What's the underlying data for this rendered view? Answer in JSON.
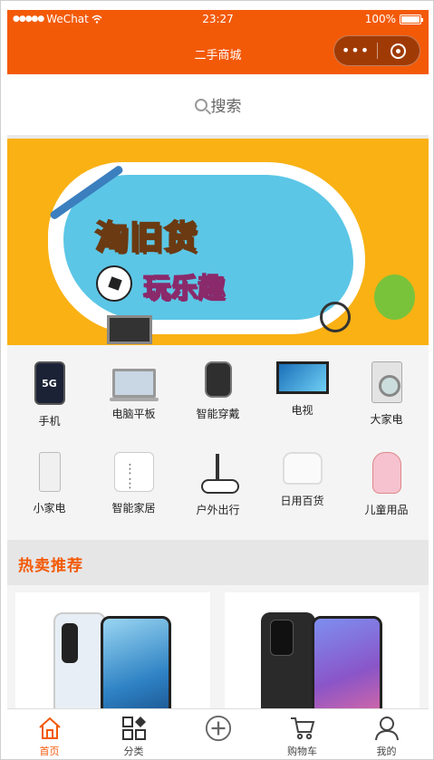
{
  "status_bar": {
    "carrier": "WeChat",
    "signal": "●●●●●",
    "time": "23:27",
    "battery": "100%",
    "battery_level": 1.0
  },
  "nav": {
    "title": "二手商城",
    "more_glyph": "•••"
  },
  "search": {
    "placeholder": "搜索"
  },
  "banner": {
    "headline": "淘旧货",
    "subline": "玩乐趣",
    "slides": 3,
    "active_slide": 0
  },
  "categories": [
    {
      "label": "手机",
      "icon": "phone-icon",
      "badge": "5G"
    },
    {
      "label": "电脑平板",
      "icon": "laptop-icon"
    },
    {
      "label": "智能穿戴",
      "icon": "smartwatch-icon"
    },
    {
      "label": "电视",
      "icon": "tv-icon"
    },
    {
      "label": "大家电",
      "icon": "washing-machine-icon"
    },
    {
      "label": "小家电",
      "icon": "air-purifier-icon"
    },
    {
      "label": "智能家居",
      "icon": "smart-socket-icon"
    },
    {
      "label": "户外出行",
      "icon": "scooter-icon"
    },
    {
      "label": "日用百货",
      "icon": "rice-cooker-icon"
    },
    {
      "label": "儿童用品",
      "icon": "toy-icon"
    }
  ],
  "section": {
    "title": "热卖推荐"
  },
  "products": [
    {
      "image": "white-smartphone-photo"
    },
    {
      "image": "black-smartphone-photo"
    }
  ],
  "tabbar": [
    {
      "label": "首页",
      "icon": "home-icon",
      "active": true
    },
    {
      "label": "分类",
      "icon": "category-grid-icon",
      "active": false
    },
    {
      "label": "",
      "icon": "plus-circle-icon",
      "active": false
    },
    {
      "label": "购物车",
      "icon": "cart-icon",
      "active": false
    },
    {
      "label": "我的",
      "icon": "user-icon",
      "active": false
    }
  ],
  "colors": {
    "accent": "#f35a08",
    "banner_bg": "#f9b114",
    "section_bg": "#e6e6e6"
  }
}
